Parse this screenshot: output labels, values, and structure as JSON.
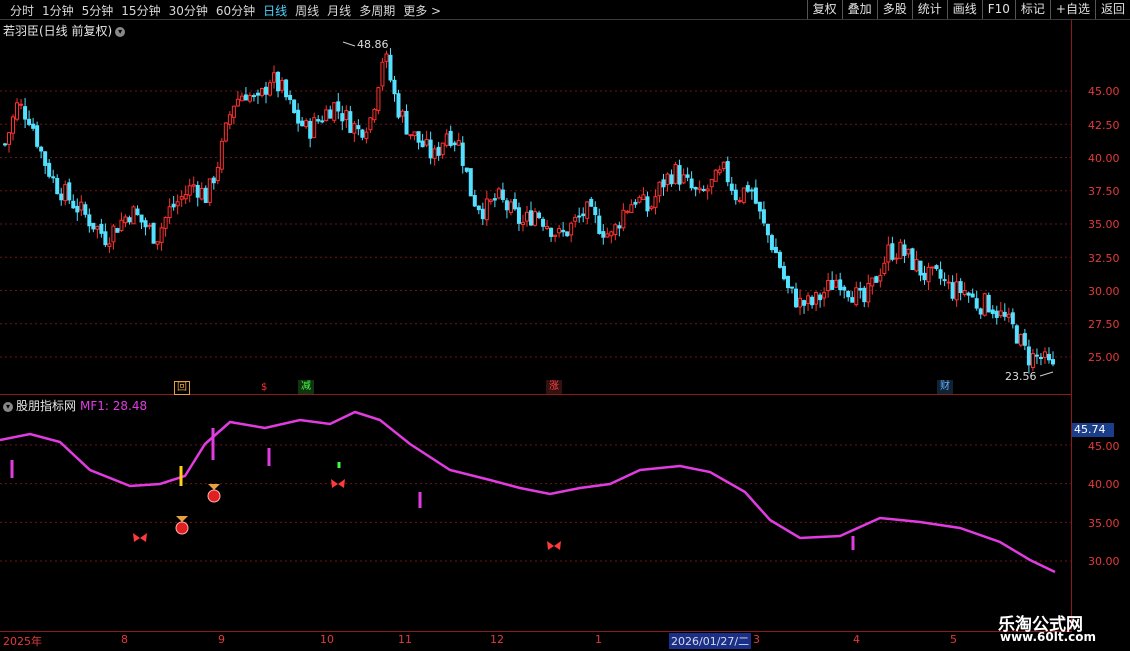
{
  "toolbar": {
    "periods": [
      "分时",
      "1分钟",
      "5分钟",
      "15分钟",
      "30分钟",
      "60分钟",
      "日线",
      "周线",
      "月线",
      "多周期",
      "更多 >"
    ],
    "active_period": "日线",
    "buttons": [
      "复权",
      "叠加",
      "多股",
      "统计",
      "画线",
      "F10",
      "标记",
      "+自选",
      "返回"
    ]
  },
  "price_panel": {
    "title": "若羽臣(日线 前复权)",
    "high_label": "48.86",
    "low_label": "23.56",
    "y_ticks": [
      "45.00",
      "42.50",
      "40.00",
      "37.50",
      "35.00",
      "32.50",
      "30.00",
      "27.50",
      "25.00"
    ],
    "signals": [
      {
        "text": "回",
        "color": "#e8a040"
      },
      {
        "text": "$",
        "color": "#ff3030"
      },
      {
        "text": "减",
        "color": "#40ff40"
      },
      {
        "text": "涨",
        "color": "#ff4040"
      },
      {
        "text": "财",
        "color": "#5fb0ff"
      }
    ]
  },
  "indicator_panel": {
    "title": "股朋指标网",
    "mf_label": "MF1: 28.48",
    "current_value": "45.74",
    "y_ticks": [
      "45.00",
      "40.00",
      "35.00",
      "30.00"
    ]
  },
  "x_axis": {
    "labels": [
      "2025年",
      "8",
      "9",
      "10",
      "11",
      "12",
      "1",
      "2026/01/27/二",
      "3",
      "4",
      "5"
    ]
  },
  "watermark": {
    "line1": "乐淘公式网",
    "line2": "www.60lt.com"
  },
  "colors": {
    "up": "#ff3030",
    "down": "#54e0ff",
    "mf_line": "#e03ce0",
    "grid": "#8b1a1a",
    "active": "#4fd2ff"
  },
  "chart_data": {
    "type": "candlestick",
    "price_closes": [
      41,
      44,
      43,
      40,
      38,
      37,
      36,
      35,
      34,
      35,
      36,
      35,
      34,
      36,
      37,
      38,
      37,
      40,
      44,
      45,
      44,
      46,
      45,
      43,
      42,
      43,
      44,
      43,
      42,
      43,
      48,
      44,
      42,
      41,
      40,
      42,
      41,
      37,
      36,
      37,
      36,
      35,
      36,
      35,
      34,
      35,
      36,
      35,
      34,
      36,
      37,
      36,
      38,
      39,
      38,
      37,
      38,
      39,
      37,
      38,
      35,
      33,
      30,
      29,
      29,
      30,
      31,
      30,
      29,
      31,
      33,
      33,
      32,
      31,
      31,
      30,
      30,
      29,
      29,
      28,
      27,
      25,
      25,
      24
    ]
  }
}
